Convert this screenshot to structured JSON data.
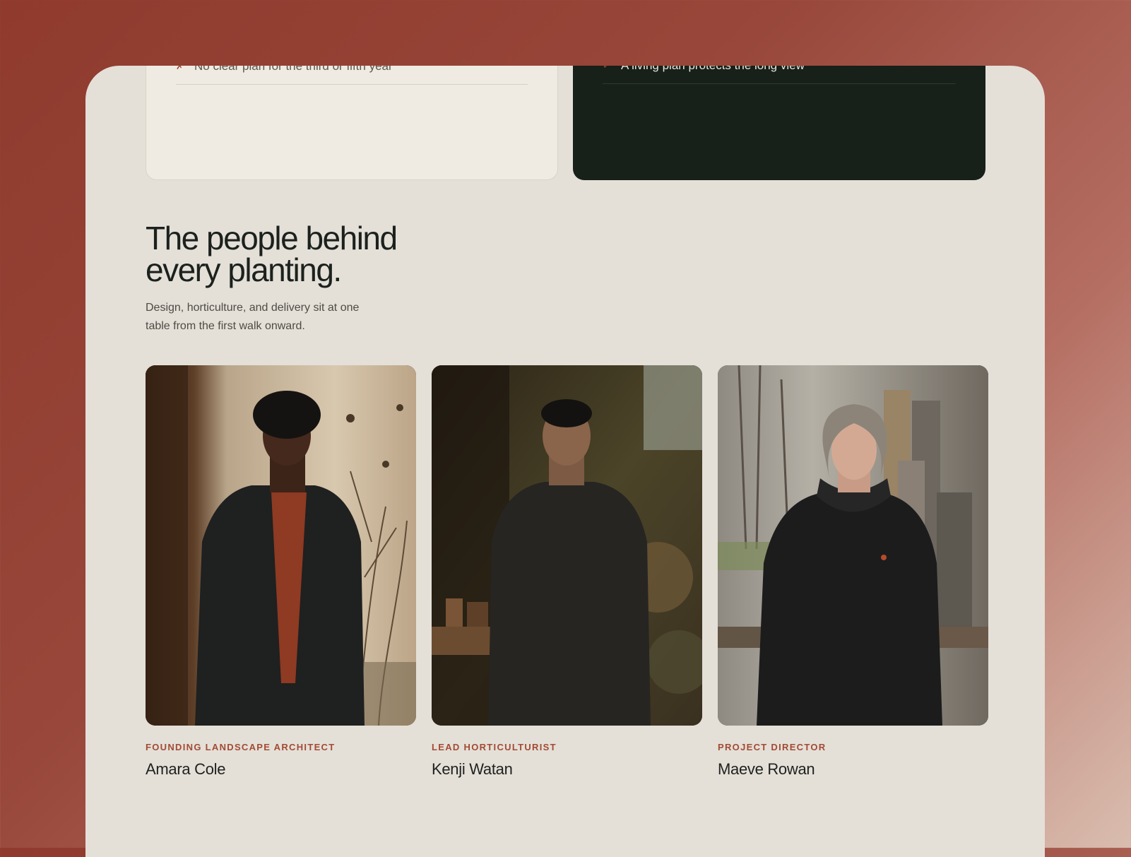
{
  "comparison": {
    "without_item": "No clear plan for the third or fifth year",
    "with_item": "A living plan protects the long view"
  },
  "team": {
    "heading": "The people behind every planting.",
    "subheading": "Design, horticulture, and delivery sit at one table from the first walk onward.",
    "members": [
      {
        "role": "FOUNDING LANDSCAPE ARCHITECT",
        "name": "Amara Cole"
      },
      {
        "role": "LEAD HORTICULTURIST",
        "name": "Kenji Watan"
      },
      {
        "role": "PROJECT DIRECTOR",
        "name": "Maeve Rowan"
      }
    ]
  },
  "colors": {
    "accent": "#a34a33",
    "panel_background": "#e4e0d8",
    "dark_card": "#172019",
    "page_background": "#98473a"
  }
}
